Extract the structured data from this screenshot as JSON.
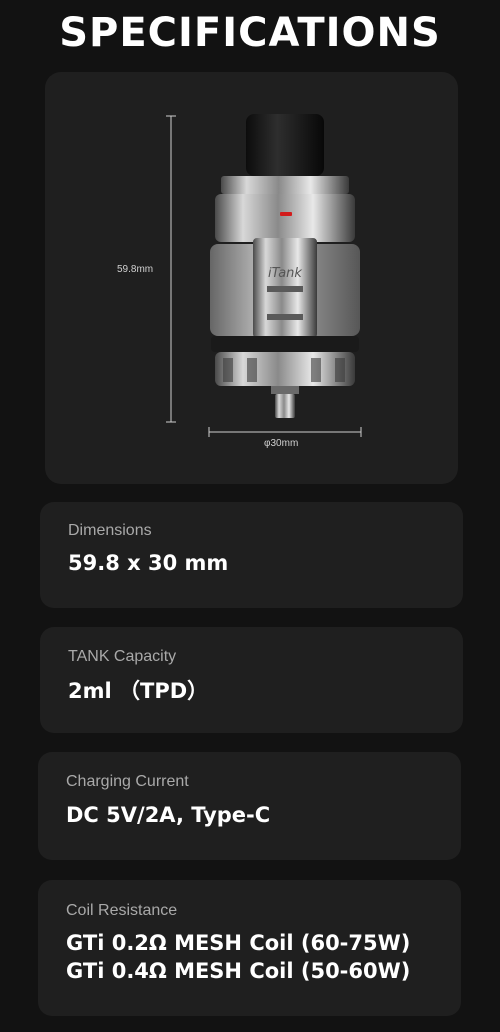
{
  "title": "SPECIFICATIONS",
  "image": {
    "height_label": "59.8mm",
    "width_label": "φ30mm",
    "tank_brand": "iTank"
  },
  "specs": [
    {
      "label": "Dimensions",
      "value": "59.8 x 30 mm"
    },
    {
      "label": "TANK Capacity",
      "value": "2ml （TPD）"
    },
    {
      "label": "Charging Current",
      "value": "DC 5V/2A, Type-C"
    },
    {
      "label": "Coil Resistance",
      "values": [
        "GTi 0.2Ω MESH Coil (60-75W)",
        "GTi 0.4Ω MESH Coil (50-60W)"
      ]
    }
  ]
}
